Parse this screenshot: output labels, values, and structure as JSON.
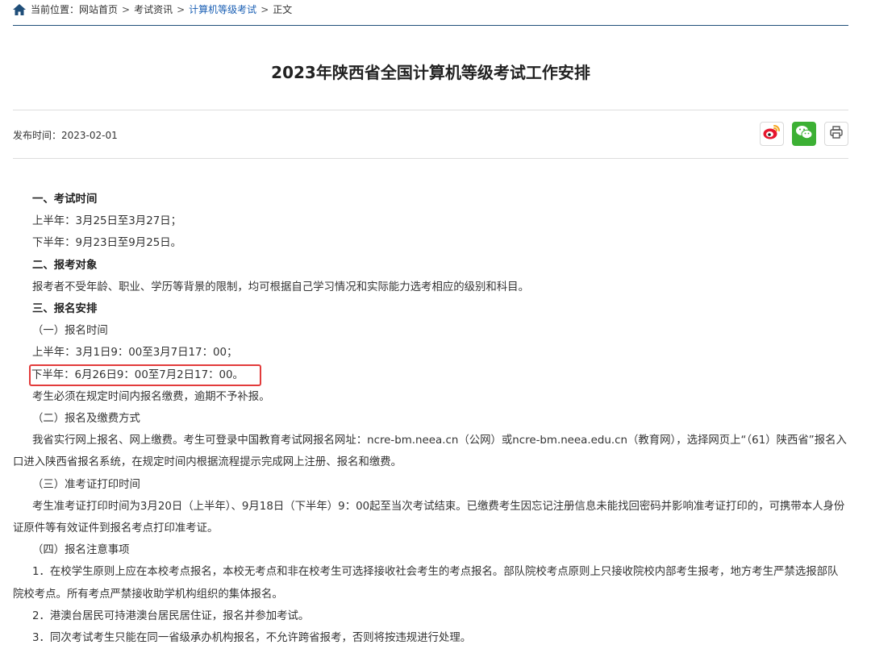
{
  "breadcrumb": {
    "prefix": "当前位置：",
    "items": [
      "网站首页",
      "考试资讯",
      "计算机等级考试",
      "正文"
    ],
    "separator": ">"
  },
  "article": {
    "title": "2023年陕西省全国计算机等级考试工作安排",
    "publish": "发布时间：2023-02-01"
  },
  "share": {
    "icons": [
      "weibo-icon",
      "wechat-icon",
      "print-icon"
    ]
  },
  "colors": {
    "breadcrumb_line": "#1f4e79",
    "active_crumb": "#1a5fb4",
    "highlight_border": "#e23b3b",
    "wechat_green": "#3cb034",
    "weibo_red": "#e6162d"
  },
  "content": {
    "s1_title": "一、考试时间",
    "s1_l1": "上半年：3月25日至3月27日；",
    "s1_l2": "下半年：9月23日至9月25日。",
    "s2_title": "二、报考对象",
    "s2_l1": "报考者不受年龄、职业、学历等背景的限制，均可根据自己学习情况和实际能力选考相应的级别和科目。",
    "s3_title": "三、报名安排",
    "s3_sub1": "（一）报名时间",
    "s3_l1": "上半年：3月1日9：00至3月7日17：00；",
    "s3_l2": "下半年：6月26日9：00至7月2日17：00。",
    "s3_l3": "考生必须在规定时间内报名缴费，逾期不予补报。",
    "s3_sub2": "（二）报名及缴费方式",
    "s3_p2": "我省实行网上报名、网上缴费。考生可登录中国教育考试网报名网址：ncre-bm.neea.cn（公网）或ncre-bm.neea.edu.cn（教育网），选择网页上“（61）陕西省”报名入口进入陕西省报名系统，在规定时间内根据流程提示完成网上注册、报名和缴费。",
    "s3_sub3": "（三）准考证打印时间",
    "s3_p3": "考生准考证打印时间为3月20日（上半年）、9月18日（下半年）9：00起至当次考试结束。已缴费考生因忘记注册信息未能找回密码并影响准考证打印的，可携带本人身份证原件等有效证件到报名考点打印准考证。",
    "s3_sub4": "（四）报名注意事项",
    "s3_n1": "1．在校学生原则上应在本校考点报名，本校无考点和非在校考生可选择接收社会考生的考点报名。部队院校考点原则上只接收院校内部考生报考，地方考生严禁选报部队院校考点。所有考点严禁接收助学机构组织的集体报名。",
    "s3_n2": "2．港澳台居民可持港澳台居民居住证，报名并参加考试。",
    "s3_n3": "3．同次考试考生只能在同一省级承办机构报名，不允许跨省报考，否则将按违规进行处理。"
  }
}
